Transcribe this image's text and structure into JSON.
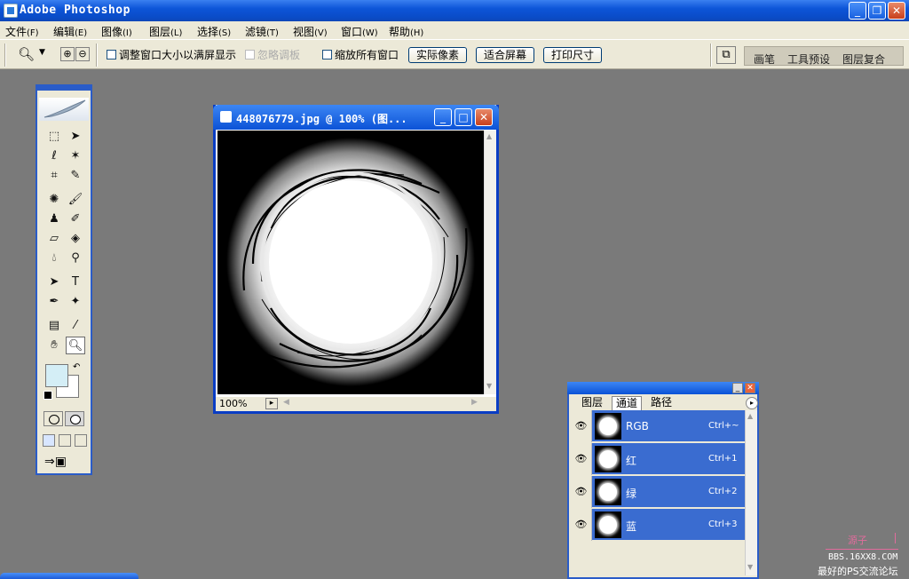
{
  "app": {
    "title": "Adobe Photoshop"
  },
  "menus": [
    {
      "label": "文件",
      "key": "(F)"
    },
    {
      "label": "编辑",
      "key": "(E)"
    },
    {
      "label": "图像",
      "key": "(I)"
    },
    {
      "label": "图层",
      "key": "(L)"
    },
    {
      "label": "选择",
      "key": "(S)"
    },
    {
      "label": "滤镜",
      "key": "(T)"
    },
    {
      "label": "视图",
      "key": "(V)"
    },
    {
      "label": "窗口",
      "key": "(W)"
    },
    {
      "label": "帮助",
      "key": "(H)"
    }
  ],
  "options": {
    "resize_windows": "调整窗口大小以满屏显示",
    "ignore_palettes": "忽略调板",
    "zoom_all": "缩放所有窗口",
    "actual_pixels": "实际像素",
    "fit_screen": "适合屏幕",
    "print_size": "打印尺寸"
  },
  "palette_well": {
    "tabs": [
      "画笔",
      "工具预设",
      "图层复合"
    ]
  },
  "document": {
    "title": "448076779.jpg @ 100% (图...",
    "zoom": "100%"
  },
  "channels_panel": {
    "tabs": [
      "图层",
      "通道",
      "路径"
    ],
    "active_tab": "通道",
    "channels": [
      {
        "name": "RGB",
        "shortcut": "Ctrl+~"
      },
      {
        "name": "红",
        "shortcut": "Ctrl+1"
      },
      {
        "name": "绿",
        "shortcut": "Ctrl+2"
      },
      {
        "name": "蓝",
        "shortcut": "Ctrl+3"
      }
    ]
  },
  "watermark": {
    "line1": "源子",
    "line2": "BBS.16XX8.COM",
    "line3": "最好的PS交流论坛"
  },
  "colors": {
    "titlebar": "#0d55d8",
    "foreground": "#d4eef6",
    "background": "#ffffff",
    "channel_selected": "#3a6cd0"
  }
}
